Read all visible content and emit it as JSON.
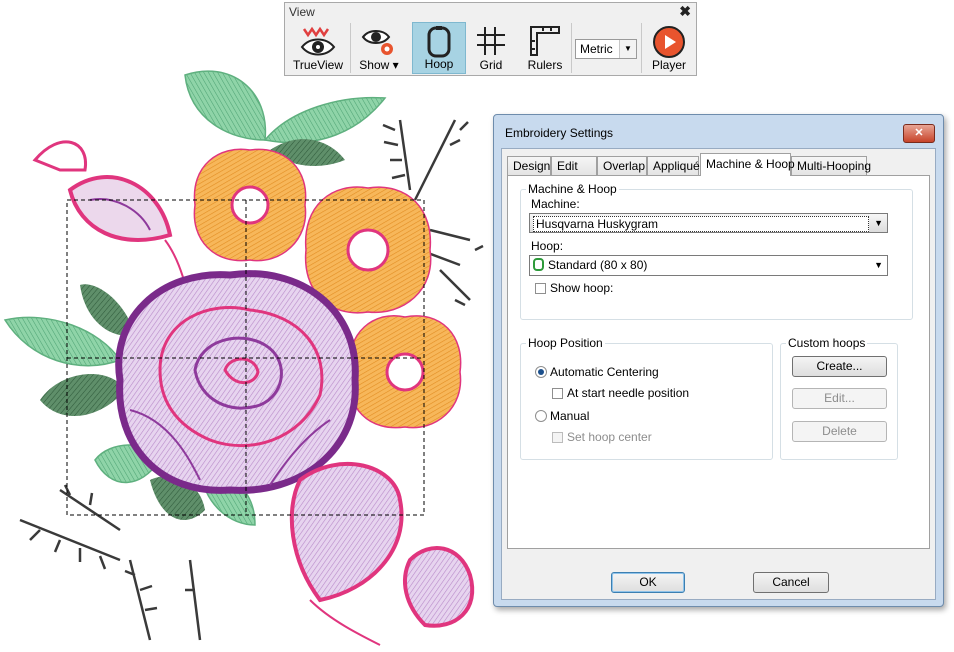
{
  "toolbar": {
    "title": "View",
    "close": "✖",
    "buttons": [
      {
        "label": "TrueView",
        "icon": "trueview-eye-icon",
        "active": false
      },
      {
        "label": "Show",
        "icon": "show-eye-gear-icon",
        "has_dropdown": true
      },
      {
        "label": "Hoop",
        "icon": "hoop-icon",
        "active": true
      },
      {
        "label": "Grid",
        "icon": "grid-icon"
      },
      {
        "label": "Rulers",
        "icon": "rulers-icon"
      },
      {
        "label": "Player",
        "icon": "player-play-icon"
      }
    ],
    "units_select": {
      "value": "Metric"
    }
  },
  "dialog": {
    "title": "Embroidery Settings",
    "close": "✕",
    "tabs": [
      "Design",
      "Edit",
      "Overlap",
      "Appliqué",
      "Machine & Hoop",
      "Multi-Hooping"
    ],
    "active_tab": "Machine & Hoop",
    "machine_hoop": {
      "group_label": "Machine & Hoop",
      "machine_label": "Machine:",
      "machine_value": "Husqvarna Huskygram",
      "hoop_label": "Hoop:",
      "hoop_value": "Standard (80 x 80)",
      "show_hoop_label": "Show hoop:",
      "show_hoop_checked": false
    },
    "hoop_position": {
      "group_label": "Hoop Position",
      "automatic_label": "Automatic Centering",
      "automatic_selected": true,
      "needle_label": "At start needle position",
      "manual_label": "Manual",
      "set_center_label": "Set hoop center"
    },
    "custom_hoops": {
      "group_label": "Custom hoops",
      "create": "Create...",
      "edit": "Edit...",
      "delete": "Delete"
    },
    "ok": "OK",
    "cancel": "Cancel"
  },
  "colors": {
    "toolbar_active": "#a7d3e3",
    "dialog_frame": "#c8daee",
    "close_red": "#c7442a",
    "thread_purple": "#8e3a9c",
    "thread_pink": "#e0357e",
    "thread_orange": "#f0a040",
    "thread_green": "#6cbf8e"
  }
}
